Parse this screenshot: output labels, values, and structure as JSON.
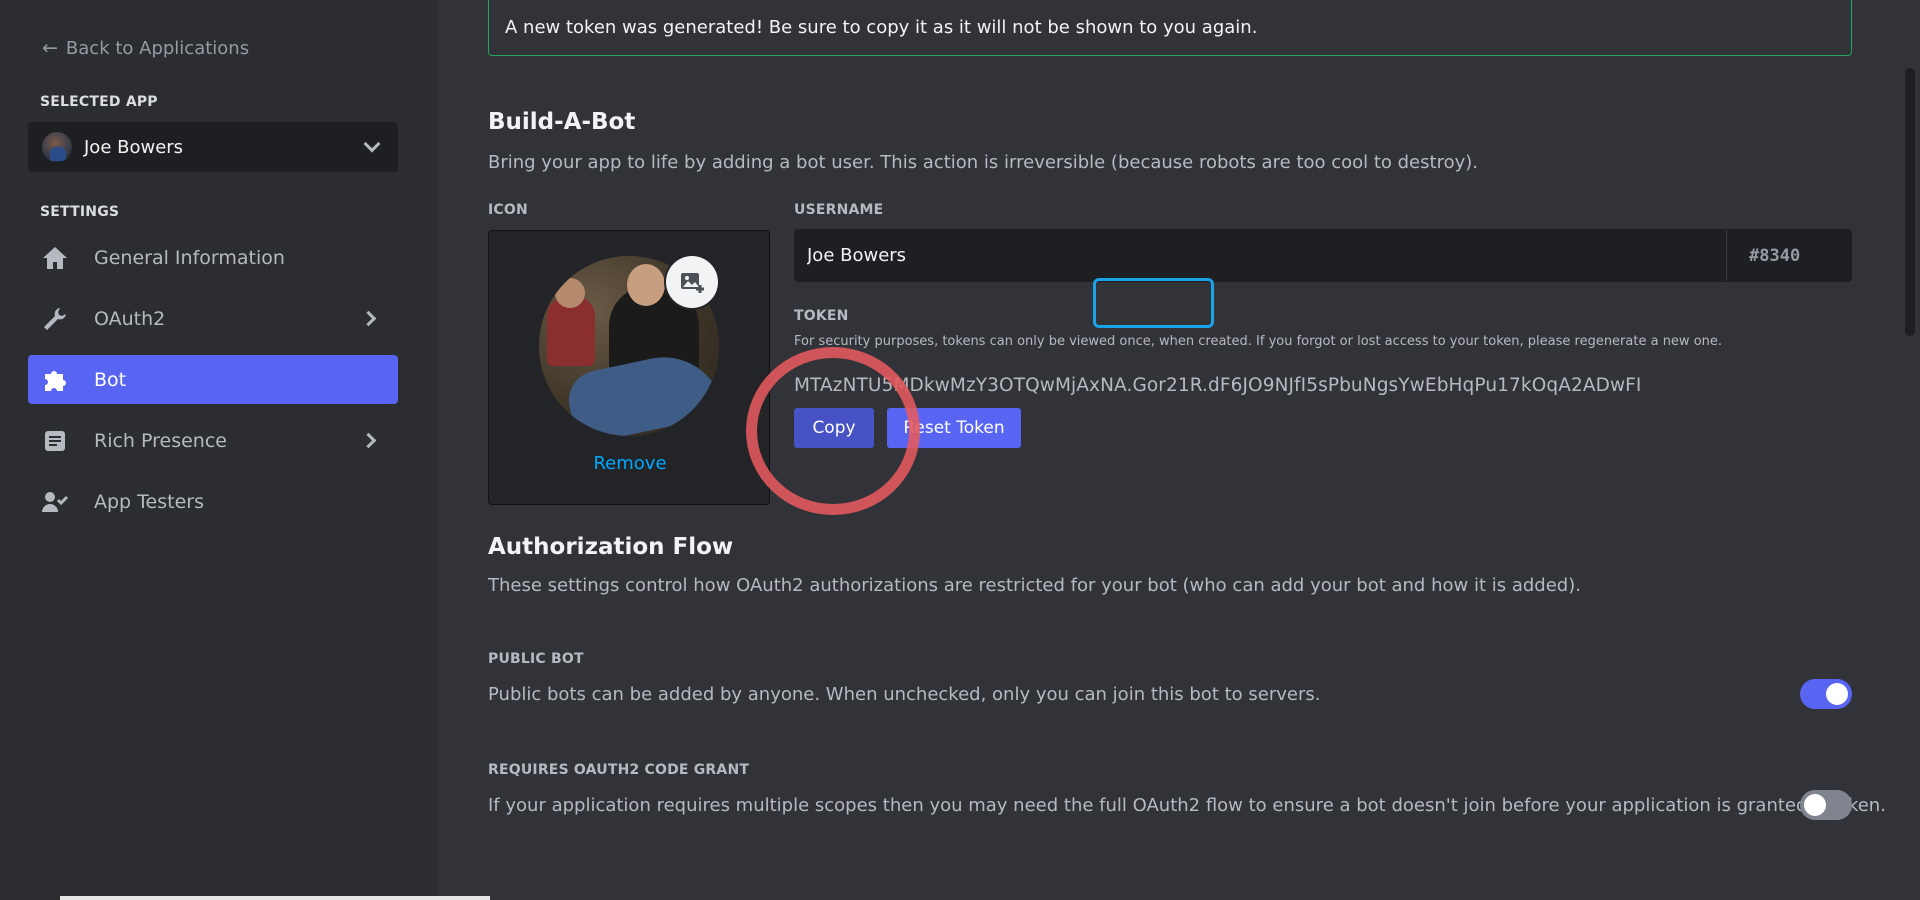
{
  "sidebar": {
    "back_label": "Back to Applications",
    "selected_app_heading": "SELECTED APP",
    "app_name": "Joe Bowers",
    "settings_heading": "SETTINGS",
    "items": [
      {
        "label": "General Information",
        "icon": "home-icon",
        "active": false,
        "has_submenu": false
      },
      {
        "label": "OAuth2",
        "icon": "wrench-icon",
        "active": false,
        "has_submenu": true
      },
      {
        "label": "Bot",
        "icon": "puzzle-icon",
        "active": true,
        "has_submenu": false
      },
      {
        "label": "Rich Presence",
        "icon": "document-icon",
        "active": false,
        "has_submenu": true
      },
      {
        "label": "App Testers",
        "icon": "person-icon",
        "active": false,
        "has_submenu": false
      }
    ]
  },
  "banner": {
    "text": "A new token was generated! Be sure to copy it as it will not be shown to you again."
  },
  "build_a_bot": {
    "title": "Build-A-Bot",
    "description": "Bring your app to life by adding a bot user. This action is irreversible (because robots are too cool to destroy).",
    "icon_label": "ICON",
    "remove_label": "Remove",
    "username_label": "USERNAME",
    "username_value": "Joe Bowers",
    "discriminator": "#8340",
    "token_label": "TOKEN",
    "token_note": "For security purposes, tokens can only be viewed once, when created. If you forgot or lost access to your token, please regenerate a new one.",
    "token_value": "MTAzNTU5MDkwMzY3OTQwMjAxNA.Gor21R.dF6JO9NJfI5sPbuNgsYwEbHqPu17kOqA2ADwFI",
    "copy_label": "Copy",
    "reset_label": "Reset Token"
  },
  "authorization_flow": {
    "title": "Authorization Flow",
    "description": "These settings control how OAuth2 authorizations are restricted for your bot (who can add your bot and how it is added).",
    "public_bot": {
      "label": "PUBLIC BOT",
      "description": "Public bots can be added by anyone. When unchecked, only you can join this bot to servers.",
      "enabled": true
    },
    "code_grant": {
      "label": "REQUIRES OAUTH2 CODE GRANT",
      "description": "If your application requires multiple scopes then you may need the full OAuth2 flow to ensure a bot doesn't join before your application is granted a token.",
      "enabled": false
    }
  },
  "colors": {
    "accent": "#5865f2",
    "sidebar_bg": "#2b2d31",
    "main_bg": "#313338",
    "success_border": "#23a55a",
    "link": "#00a8fc"
  }
}
